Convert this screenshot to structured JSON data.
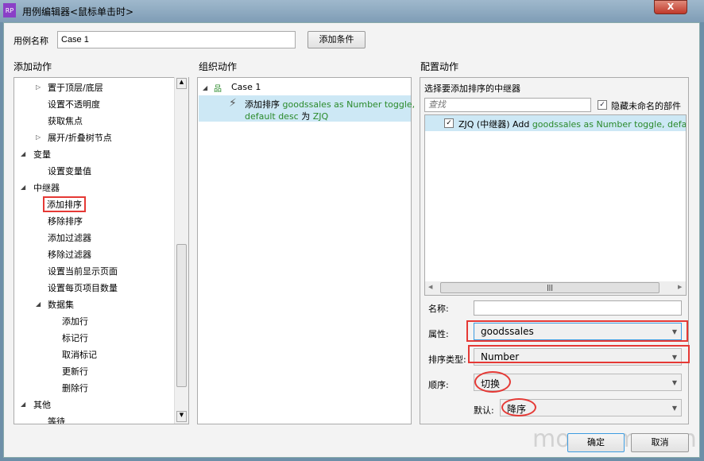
{
  "window": {
    "title": "用例编辑器<鼠标单击时>",
    "app_icon": "RP",
    "close": "X"
  },
  "case_name": {
    "label": "用例名称",
    "value": "Case 1"
  },
  "add_condition": "添加条件",
  "sections": {
    "add_action": "添加动作",
    "organize": "组织动作",
    "configure": "配置动作"
  },
  "tree": [
    {
      "label": "置于顶层/底层",
      "level": 2,
      "toggle": "collapsed"
    },
    {
      "label": "设置不透明度",
      "level": 2
    },
    {
      "label": "获取焦点",
      "level": 2
    },
    {
      "label": "展开/折叠树节点",
      "level": 2,
      "toggle": "collapsed"
    },
    {
      "label": "变量",
      "level": 1,
      "toggle": "expanded"
    },
    {
      "label": "设置变量值",
      "level": 2
    },
    {
      "label": "中继器",
      "level": 1,
      "toggle": "expanded"
    },
    {
      "label": "添加排序",
      "level": 2,
      "highlighted": true
    },
    {
      "label": "移除排序",
      "level": 2
    },
    {
      "label": "添加过滤器",
      "level": 2
    },
    {
      "label": "移除过滤器",
      "level": 2
    },
    {
      "label": "设置当前显示页面",
      "level": 2
    },
    {
      "label": "设置每页项目数量",
      "level": 2
    },
    {
      "label": "数据集",
      "level": 2,
      "toggle": "expanded"
    },
    {
      "label": "添加行",
      "level": 3
    },
    {
      "label": "标记行",
      "level": 3
    },
    {
      "label": "取消标记",
      "level": 3
    },
    {
      "label": "更新行",
      "level": 3
    },
    {
      "label": "删除行",
      "level": 3
    },
    {
      "label": "其他",
      "level": 1,
      "toggle": "expanded"
    },
    {
      "label": "等待",
      "level": 2
    }
  ],
  "organize": {
    "case": "Case 1",
    "action_name": "添加排序",
    "action_detail_1": "goodssales as Number toggle,",
    "action_detail_2": "default desc",
    "action_for": "为",
    "action_target": "ZJQ"
  },
  "configure": {
    "heading": "选择要添加排序的中继器",
    "search_placeholder": "查找",
    "hide_unnamed": "隐藏未命名的部件",
    "hide_unnamed_checked": true,
    "repeater_item_prefix": "ZJQ (中继器) Add",
    "repeater_item_detail": "goodssales as Number toggle, default de",
    "repeater_checked": true,
    "name_label": "名称:",
    "name_value": "",
    "property_label": "属性:",
    "property_value": "goodssales",
    "sort_type_label": "排序类型:",
    "sort_type_value": "Number",
    "order_label": "顺序:",
    "order_value": "切换",
    "default_label": "默认:",
    "default_value": "降序"
  },
  "buttons": {
    "ok": "确定",
    "cancel": "取消"
  },
  "watermark": "moonpm.com"
}
